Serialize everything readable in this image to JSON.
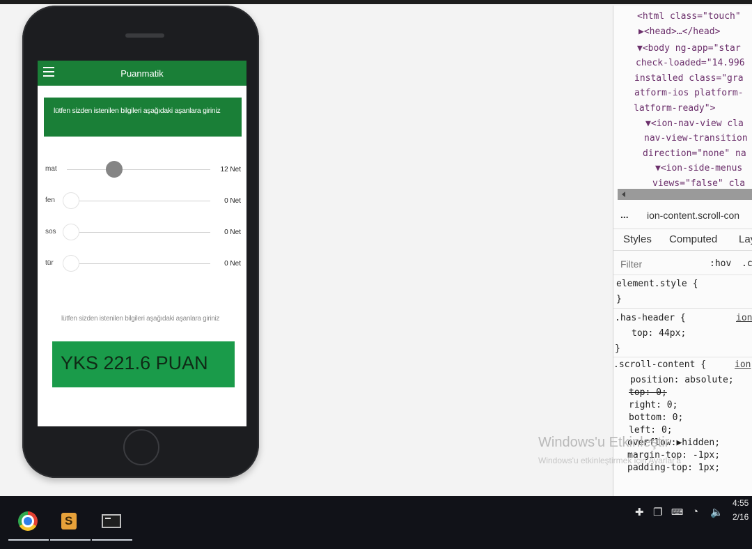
{
  "app": {
    "title": "Puanmatik",
    "info_text": "lütfen sizden istenilen bilgileri aşağıdaki aşanlara giriniz",
    "sliders": [
      {
        "label": "mat",
        "value": "12 Net",
        "fill": 0.35
      },
      {
        "label": "fen",
        "value": "0 Net",
        "fill": 0
      },
      {
        "label": "sos",
        "value": "0 Net",
        "fill": 0
      },
      {
        "label": "tür",
        "value": "0 Net",
        "fill": 0
      }
    ],
    "hint_text": "lütfen sizden istenilen bilgileri aşağıdaki aşanlara giriniz",
    "result": "YKS 221.6 PUAN",
    "colors": {
      "header": "#1a7f37",
      "info_box": "#1a7f37",
      "result_box": "#1a9b4a",
      "active_knob": "#858585"
    }
  },
  "devtools": {
    "dom_lines": [
      "<html class=\"touch\"",
      "▶<head>…</head>",
      "▼<body ng-app=\"star",
      "check-loaded=\"14.996",
      "installed class=\"gra",
      "atform-ios platform-",
      "latform-ready\">",
      "▼<ion-nav-view cla",
      "nav-view-transition",
      "direction=\"none\" na",
      "▼<ion-side-menus",
      "views=\"false\" cla"
    ],
    "breadcrumb_dots": "...",
    "breadcrumb": "ion-content.scroll-con",
    "tabs": [
      "Styles",
      "Computed",
      "Lay"
    ],
    "filter_placeholder": "Filter",
    "hov_label": ":hov",
    "cls_label": ".c",
    "rules": {
      "element_style": "element.style {",
      "close1": "}",
      "has_header": ".has-header {",
      "has_header_src": "ion",
      "top_decl": "top: 44px;",
      "close2": "}",
      "scroll_content": ".scroll-content {",
      "scroll_src": "ion",
      "position": "position: absolute;",
      "top_zero": "top: 0;",
      "right": "right: 0;",
      "bottom": "bottom: 0;",
      "left": "left: 0;",
      "overflow": "overflow:▶hidden;",
      "margin_top": "margin-top: -1px;",
      "padding_top": "padding-top: 1px;"
    }
  },
  "watermark": {
    "title": "Windows'u Etkinleştir",
    "subtitle": "Windows'u etkinleştirmek için Ayarlar'a"
  },
  "taskbar": {
    "apps": [
      "chrome-icon",
      "sublime-icon",
      "cmd-icon"
    ],
    "clock_time": "4:55",
    "clock_date": "2/16"
  }
}
